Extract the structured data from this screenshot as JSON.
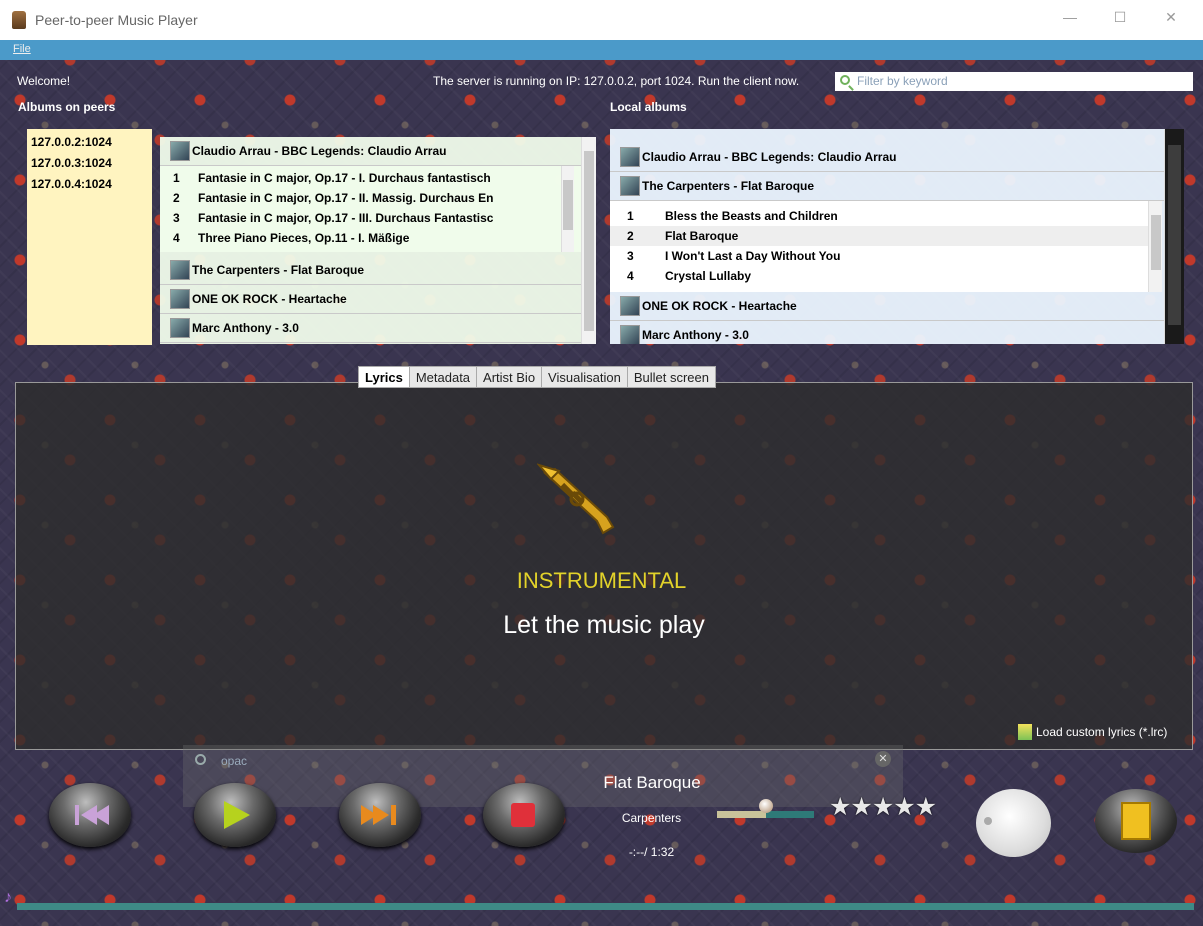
{
  "window": {
    "title": "Peer-to-peer Music Player",
    "minimize": "—",
    "maximize": "☐",
    "close": "✕"
  },
  "menubar": {
    "file": "File"
  },
  "header": {
    "welcome": "Welcome!",
    "server_status": "The server is running on IP: 127.0.0.2, port 1024. Run the client now.",
    "filter_placeholder": "Filter by keyword"
  },
  "albums_on_peers": {
    "heading": "Albums on peers",
    "peers": [
      "127.0.0.2:1024",
      "127.0.0.3:1024",
      "127.0.0.4:1024"
    ],
    "albums": [
      {
        "title": "Claudio Arrau - BBC Legends: Claudio Arrau",
        "tracks": [
          {
            "num": "1",
            "name": "Fantasie in C major, Op.17 - I. Durchaus fantastisch"
          },
          {
            "num": "2",
            "name": "Fantasie in C major, Op.17 - II. Massig. Durchaus En"
          },
          {
            "num": "3",
            "name": "Fantasie in C major, Op.17 - III. Durchaus Fantastisc"
          },
          {
            "num": "4",
            "name": "Three Piano Pieces, Op.11 - I. Mäßige"
          }
        ]
      },
      {
        "title": "The Carpenters - Flat Baroque"
      },
      {
        "title": "ONE OK ROCK - Heartache"
      },
      {
        "title": "Marc Anthony - 3.0"
      }
    ]
  },
  "local_albums": {
    "heading": "Local albums",
    "albums": [
      {
        "title": "Claudio Arrau - BBC Legends: Claudio Arrau"
      },
      {
        "title": "The Carpenters - Flat Baroque",
        "tracks": [
          {
            "num": "1",
            "name": "Bless the Beasts and Children"
          },
          {
            "num": "2",
            "name": "Flat Baroque"
          },
          {
            "num": "3",
            "name": "I Won't Last a Day Without You"
          },
          {
            "num": "4",
            "name": "Crystal Lullaby"
          }
        ]
      },
      {
        "title": "ONE OK ROCK - Heartache"
      },
      {
        "title": "Marc Anthony - 3.0"
      }
    ]
  },
  "tabs": [
    "Lyrics",
    "Metadata",
    "Artist Bio",
    "Visualisation",
    "Bullet screen"
  ],
  "lyrics_panel": {
    "status": "INSTRUMENTAL",
    "message": "Let the music play",
    "load_button": "Load custom lyrics (*.lrc)"
  },
  "find_bar": {
    "text": "opac",
    "clear": "✕"
  },
  "player": {
    "song": "Flat Baroque",
    "artist": "Carpenters",
    "time": "-:--/ 1:32",
    "rating_stars": "★★★★★",
    "volume_fraction": 0.5,
    "progress_fraction": 0.0
  },
  "icons": {
    "music_note": "♪"
  }
}
